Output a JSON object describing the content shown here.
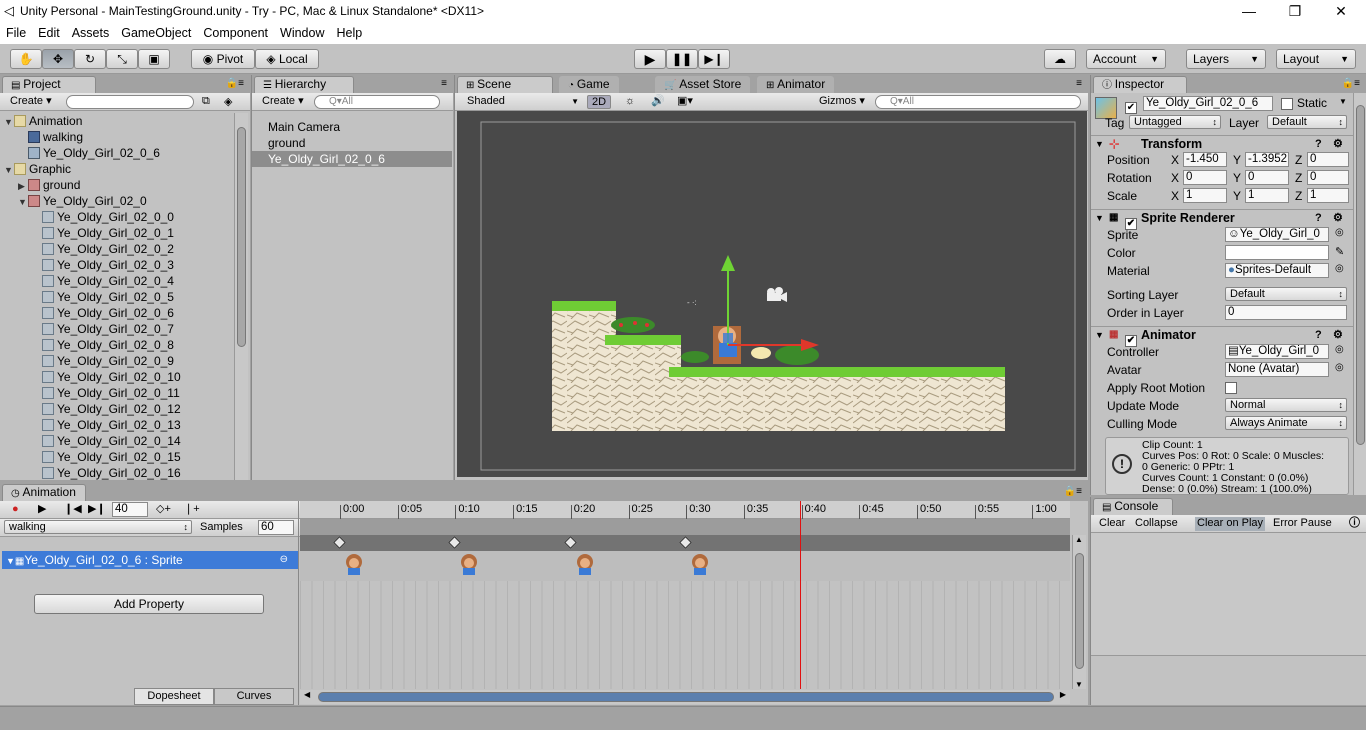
{
  "window": {
    "title": "Unity Personal - MainTestingGround.unity - Try - PC, Mac & Linux Standalone* <DX11>"
  },
  "menu": [
    "File",
    "Edit",
    "Assets",
    "GameObject",
    "Component",
    "Window",
    "Help"
  ],
  "toolbar": {
    "pivot": "Pivot",
    "local": "Local",
    "account": "Account",
    "layers": "Layers",
    "layout": "Layout"
  },
  "project": {
    "tab": "Project",
    "create": "Create",
    "items": [
      {
        "label": "Animation",
        "depth": 0,
        "fold": "▼",
        "icon": "folder"
      },
      {
        "label": "walking",
        "depth": 1,
        "fold": "",
        "icon": "anim"
      },
      {
        "label": "Ye_Oldy_Girl_02_0_6",
        "depth": 1,
        "fold": "",
        "icon": "ctrl"
      },
      {
        "label": "Graphic",
        "depth": 0,
        "fold": "▼",
        "icon": "folder"
      },
      {
        "label": "ground",
        "depth": 1,
        "fold": "▶",
        "icon": "sprsheet"
      },
      {
        "label": "Ye_Oldy_Girl_02_0",
        "depth": 1,
        "fold": "▼",
        "icon": "sprsheet"
      },
      {
        "label": "Ye_Oldy_Girl_02_0_0",
        "depth": 2,
        "fold": "",
        "icon": "spr"
      },
      {
        "label": "Ye_Oldy_Girl_02_0_1",
        "depth": 2,
        "fold": "",
        "icon": "spr"
      },
      {
        "label": "Ye_Oldy_Girl_02_0_2",
        "depth": 2,
        "fold": "",
        "icon": "spr"
      },
      {
        "label": "Ye_Oldy_Girl_02_0_3",
        "depth": 2,
        "fold": "",
        "icon": "spr"
      },
      {
        "label": "Ye_Oldy_Girl_02_0_4",
        "depth": 2,
        "fold": "",
        "icon": "spr"
      },
      {
        "label": "Ye_Oldy_Girl_02_0_5",
        "depth": 2,
        "fold": "",
        "icon": "spr"
      },
      {
        "label": "Ye_Oldy_Girl_02_0_6",
        "depth": 2,
        "fold": "",
        "icon": "spr"
      },
      {
        "label": "Ye_Oldy_Girl_02_0_7",
        "depth": 2,
        "fold": "",
        "icon": "spr"
      },
      {
        "label": "Ye_Oldy_Girl_02_0_8",
        "depth": 2,
        "fold": "",
        "icon": "spr"
      },
      {
        "label": "Ye_Oldy_Girl_02_0_9",
        "depth": 2,
        "fold": "",
        "icon": "spr"
      },
      {
        "label": "Ye_Oldy_Girl_02_0_10",
        "depth": 2,
        "fold": "",
        "icon": "spr"
      },
      {
        "label": "Ye_Oldy_Girl_02_0_11",
        "depth": 2,
        "fold": "",
        "icon": "spr"
      },
      {
        "label": "Ye_Oldy_Girl_02_0_12",
        "depth": 2,
        "fold": "",
        "icon": "spr"
      },
      {
        "label": "Ye_Oldy_Girl_02_0_13",
        "depth": 2,
        "fold": "",
        "icon": "spr"
      },
      {
        "label": "Ye_Oldy_Girl_02_0_14",
        "depth": 2,
        "fold": "",
        "icon": "spr"
      },
      {
        "label": "Ye_Oldy_Girl_02_0_15",
        "depth": 2,
        "fold": "",
        "icon": "spr"
      },
      {
        "label": "Ye_Oldy_Girl_02_0_16",
        "depth": 2,
        "fold": "",
        "icon": "spr"
      }
    ]
  },
  "hierarchy": {
    "tab": "Hierarchy",
    "create": "Create",
    "search": "Q▾All",
    "items": [
      "Main Camera",
      "ground",
      "Ye_Oldy_Girl_02_0_6"
    ],
    "selected": 2
  },
  "scene": {
    "tabs": [
      "Scene",
      "Game",
      "Asset Store",
      "Animator"
    ],
    "shaded": "Shaded",
    "mode2d": "2D",
    "gizmos": "Gizmos",
    "search": "Q▾All"
  },
  "inspector": {
    "tab": "Inspector",
    "name": "Ye_Oldy_Girl_02_0_6",
    "static": "Static",
    "tag_label": "Tag",
    "tag": "Untagged",
    "layer_label": "Layer",
    "layer": "Default",
    "transform": {
      "title": "Transform",
      "position_label": "Position",
      "rotation_label": "Rotation",
      "scale_label": "Scale",
      "position": [
        "-1.450",
        "-1.3952",
        "0"
      ],
      "rotation": [
        "0",
        "0",
        "0"
      ],
      "scale": [
        "1",
        "1",
        "1"
      ],
      "axes": [
        "X",
        "Y",
        "Z"
      ]
    },
    "sprite_renderer": {
      "title": "Sprite Renderer",
      "sprite_label": "Sprite",
      "sprite": "Ye_Oldy_Girl_0",
      "color_label": "Color",
      "material_label": "Material",
      "material": "Sprites-Default",
      "sorting_layer_label": "Sorting Layer",
      "sorting_layer": "Default",
      "order_label": "Order in Layer",
      "order": "0"
    },
    "animator": {
      "title": "Animator",
      "controller_label": "Controller",
      "controller": "Ye_Oldy_Girl_0",
      "avatar_label": "Avatar",
      "avatar": "None (Avatar)",
      "root_motion_label": "Apply Root Motion",
      "update_label": "Update Mode",
      "update": "Normal",
      "culling_label": "Culling Mode",
      "culling": "Always Animate"
    },
    "info": [
      "Clip Count: 1",
      "Curves Pos: 0 Rot: 0 Scale: 0 Muscles:",
      "0 Generic: 0 PPtr: 1",
      "Curves Count: 1 Constant: 0 (0.0%)",
      "Dense: 0 (0.0%) Stream: 1 (100.0%)"
    ]
  },
  "animation": {
    "tab": "Animation",
    "frame": "40",
    "clip": "walking",
    "samples_label": "Samples",
    "samples": "60",
    "property": "Ye_Oldy_Girl_02_0_6 : Sprite",
    "add_property": "Add Property",
    "dopesheet": "Dopesheet",
    "curves": "Curves",
    "ticks": [
      "0:00",
      "0:05",
      "0:10",
      "0:15",
      "0:20",
      "0:25",
      "0:30",
      "0:35",
      "0:40",
      "0:45",
      "0:50",
      "0:55",
      "1:00"
    ]
  },
  "console": {
    "tab": "Console",
    "buttons": [
      "Clear",
      "Collapse",
      "Clear on Play",
      "Error Pause"
    ]
  }
}
